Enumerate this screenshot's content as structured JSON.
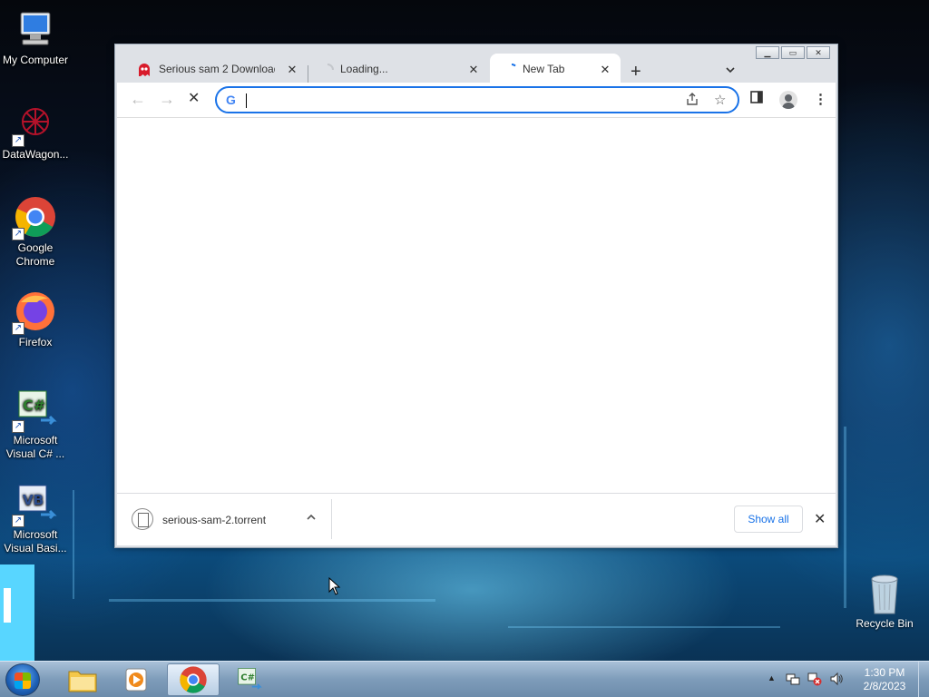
{
  "desktop": {
    "icons": [
      {
        "label": "My Computer",
        "icon": "computer-icon"
      },
      {
        "label": "DataWagon...",
        "icon": "datawagon-icon"
      },
      {
        "label": "Google Chrome",
        "icon": "chrome-icon"
      },
      {
        "label": "Firefox",
        "icon": "firefox-icon"
      },
      {
        "label": "Microsoft Visual C# ...",
        "icon": "visual-csharp-icon"
      },
      {
        "label": "Microsoft Visual Basi...",
        "icon": "visual-basic-icon"
      }
    ],
    "recycle_bin": {
      "label": "Recycle Bin",
      "icon": "recycle-bin-icon"
    }
  },
  "browser": {
    "tabs": [
      {
        "title": "Serious sam 2 Download",
        "icon": "ghost-favicon",
        "active": false
      },
      {
        "title": "Loading...",
        "icon": "loading-spinner-icon",
        "active": false
      },
      {
        "title": "New Tab",
        "icon": "loading-spinner-icon",
        "active": true
      }
    ],
    "new_tab_symbol": "+",
    "address_bar": {
      "value": "",
      "icon": "google-g-icon",
      "logo_text": "G"
    },
    "download": {
      "filename": "serious-sam-2.torrent",
      "show_all_label": "Show all"
    },
    "colors": {
      "accent": "#1a73e8",
      "tabstrip": "#dee1e6"
    }
  },
  "taskbar": {
    "apps": [
      "file-explorer",
      "media-player",
      "google-chrome",
      "visual-csharp"
    ],
    "active_app": "google-chrome",
    "clock": {
      "time": "1:30 PM",
      "date": "2/8/2023"
    }
  }
}
